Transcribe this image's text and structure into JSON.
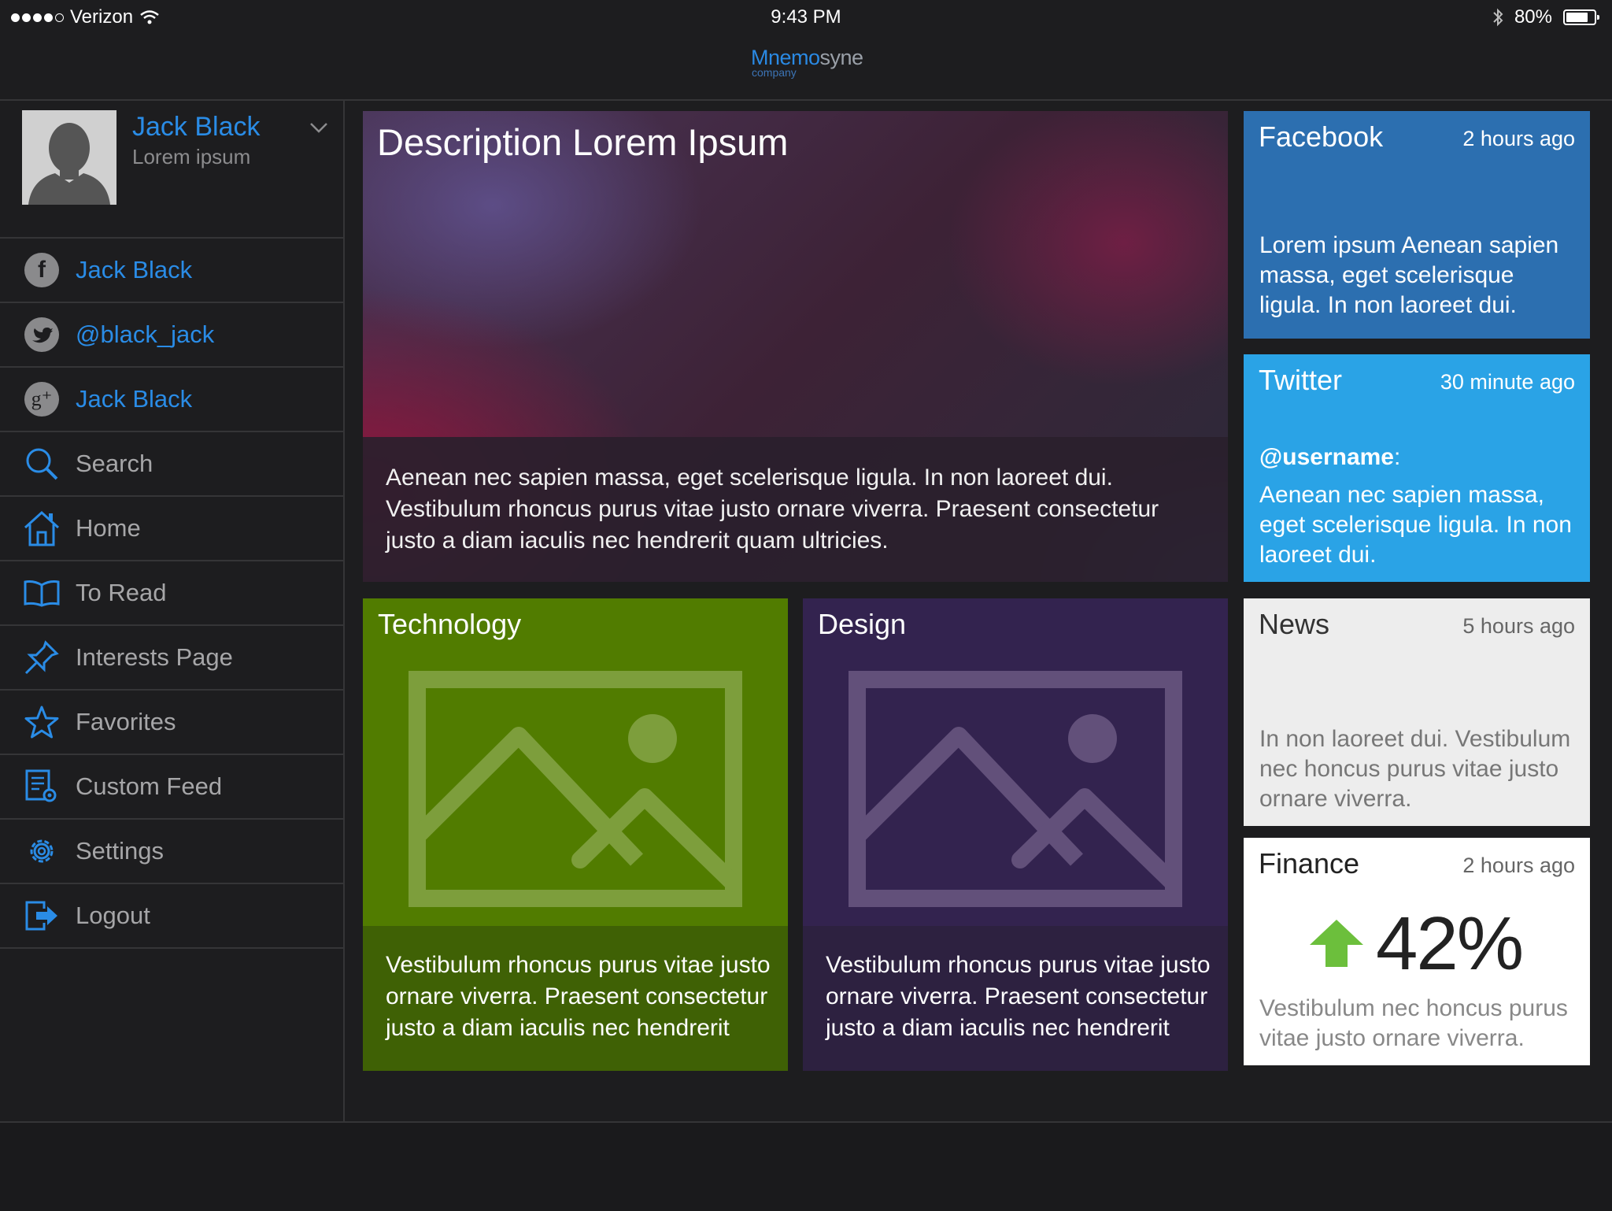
{
  "status_bar": {
    "carrier": "Verizon",
    "time": "9:43 PM",
    "battery": "80%",
    "battery_level": 0.8,
    "signal_bars": 4,
    "signal_total": 5
  },
  "brand": {
    "name_part1": "Mnemo",
    "name_part2": "syne",
    "subtitle": "company"
  },
  "profile": {
    "name": "Jack Black",
    "subtitle": "Lorem ipsum"
  },
  "nav": {
    "items": [
      {
        "label": "Jack Black",
        "icon": "facebook-icon"
      },
      {
        "label": "@black_jack",
        "icon": "twitter-icon"
      },
      {
        "label": "Jack Black",
        "icon": "google-plus-icon"
      },
      {
        "label": "Search",
        "icon": "search-icon"
      },
      {
        "label": "Home",
        "icon": "home-icon"
      },
      {
        "label": "To Read",
        "icon": "book-icon"
      },
      {
        "label": "Interests Page",
        "icon": "pin-icon"
      },
      {
        "label": "Favorites",
        "icon": "star-icon"
      },
      {
        "label": "Custom Feed",
        "icon": "feed-settings-icon"
      },
      {
        "label": "Settings",
        "icon": "gear-icon"
      },
      {
        "label": "Logout",
        "icon": "logout-icon"
      }
    ]
  },
  "hero": {
    "title": "Description Lorem Ipsum",
    "text": "Aenean nec sapien massa, eget scelerisque ligula. In non laoreet dui. Vestibulum rhoncus purus vitae justo ornare viverra. Praesent consectetur justo a diam iaculis nec hendrerit quam ultricies."
  },
  "tiles": [
    {
      "title": "Technology",
      "text": "Vestibulum rhoncus purus vitae justo ornare viverra. Praesent consectetur justo a diam iaculis nec hendrerit",
      "color": "#517c00",
      "foot_color": "#3f6105"
    },
    {
      "title": "Design",
      "text": "Vestibulum rhoncus purus vitae justo ornare viverra. Praesent consectetur justo a diam iaculis nec hendrerit",
      "color": "#33234f",
      "foot_color": "#2d2140"
    }
  ],
  "cards": {
    "facebook": {
      "title": "Facebook",
      "time": "2 hours ago",
      "text": "Lorem ipsum Aenean sapien massa, eget scelerisque ligula. In non laoreet dui.",
      "color": "#2c6fb0"
    },
    "twitter": {
      "title": "Twitter",
      "time": "30 minute ago",
      "username": "@username",
      "text": "Aenean nec sapien massa, eget scelerisque ligula. In non laoreet dui.",
      "color": "#2aa3e6"
    },
    "news": {
      "title": "News",
      "time": "5 hours ago",
      "text": "In non laoreet dui. Vestibulum nec honcus purus vitae justo ornare viverra.",
      "color": "#ededed"
    },
    "finance": {
      "title": "Finance",
      "time": "2 hours ago",
      "value": "42%",
      "text": "Vestibulum nec honcus purus vitae justo ornare viverra.",
      "color": "#ffffff",
      "trend_color": "#6cbf3c"
    }
  }
}
